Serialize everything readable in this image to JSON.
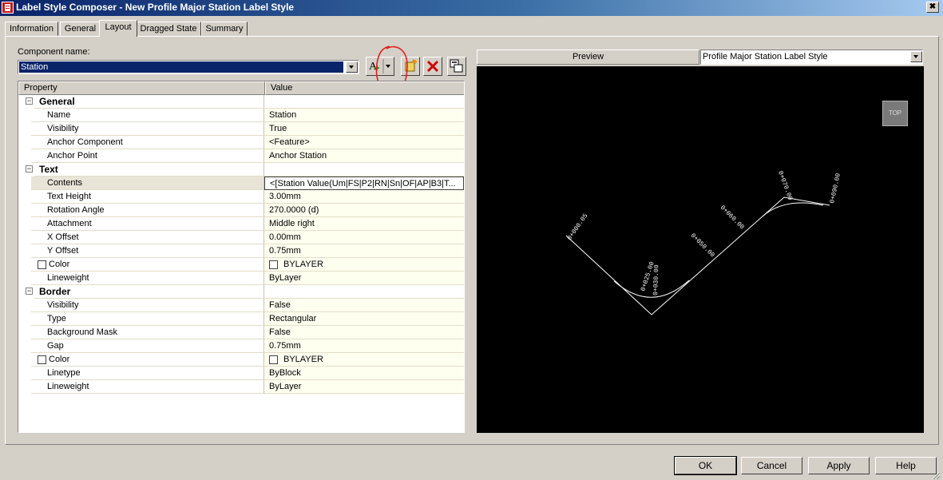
{
  "window": {
    "title": "Label Style Composer - New Profile Major Station Label Style",
    "close_glyph": "✖"
  },
  "tabs": [
    {
      "label": "Information"
    },
    {
      "label": "General"
    },
    {
      "label": "Layout",
      "active": true
    },
    {
      "label": "Dragged State"
    },
    {
      "label": "Summary"
    }
  ],
  "component": {
    "label": "Component name:",
    "value": "Station"
  },
  "grid": {
    "headers": {
      "property": "Property",
      "value": "Value"
    },
    "rows": [
      {
        "type": "category",
        "name": "General",
        "value": ""
      },
      {
        "name": "Name",
        "value": "Station"
      },
      {
        "name": "Visibility",
        "value": "True"
      },
      {
        "name": "Anchor Component",
        "value": "<Feature>"
      },
      {
        "name": "Anchor Point",
        "value": "Anchor Station"
      },
      {
        "type": "category",
        "name": "Text",
        "value": ""
      },
      {
        "name": "Contents",
        "value": "<[Station Value(Um|FS|P2|RN|Sn|OF|AP|B3|T...",
        "selected": true
      },
      {
        "name": "Text Height",
        "value": "3.00mm"
      },
      {
        "name": "Rotation Angle",
        "value": "270.0000 (d)"
      },
      {
        "name": "Attachment",
        "value": "Middle right"
      },
      {
        "name": "X Offset",
        "value": "0.00mm"
      },
      {
        "name": "Y Offset",
        "value": "0.75mm"
      },
      {
        "name": "Color",
        "value": "BYLAYER",
        "checkbox": true
      },
      {
        "name": "Lineweight",
        "value": "ByLayer"
      },
      {
        "type": "category",
        "name": "Border",
        "value": ""
      },
      {
        "name": "Visibility",
        "value": "False"
      },
      {
        "name": "Type",
        "value": "Rectangular"
      },
      {
        "name": "Background Mask",
        "value": "False"
      },
      {
        "name": "Gap",
        "value": "0.75mm"
      },
      {
        "name": "Color",
        "value": "BYLAYER",
        "checkbox": true
      },
      {
        "name": "Linetype",
        "value": "ByBlock"
      },
      {
        "name": "Lineweight",
        "value": "ByLayer"
      }
    ]
  },
  "preview": {
    "label": "Preview",
    "style": "Profile Major Station Label Style",
    "view_cube": "TOP",
    "station_labels": [
      "0+000.05",
      "0+025.00",
      "0+030.00",
      "0+050.00",
      "0+060.00",
      "0+070.00",
      "0+090.00"
    ]
  },
  "buttons": {
    "ok": "OK",
    "cancel": "Cancel",
    "apply": "Apply",
    "help": "Help"
  },
  "colors": {
    "titlebar": "#0a246a",
    "selection": "#0a246a",
    "annotation": "#e0201c",
    "delete": "#d00000"
  }
}
